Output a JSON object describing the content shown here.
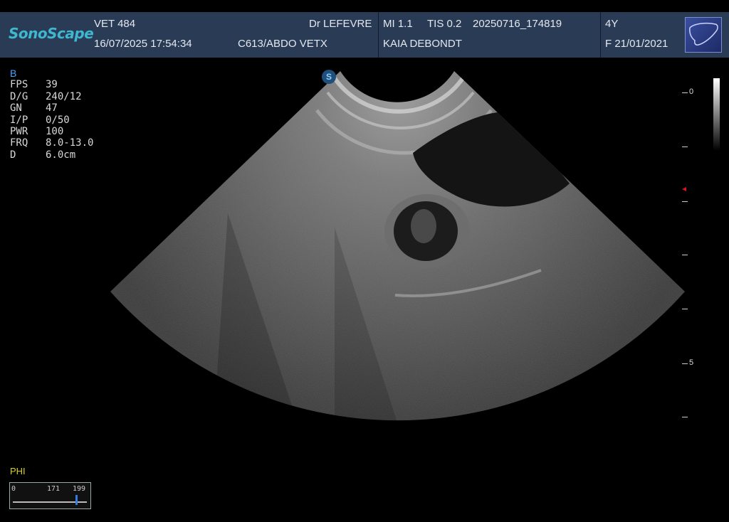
{
  "header": {
    "logo": "SonoScape",
    "institution": "VET 484",
    "datetime": "16/07/2025 17:54:34",
    "operator": "Dr LEFEVRE",
    "probe_preset": "C613/ABDO VETX",
    "mi": "MI  1.1",
    "tis": "TIS 0.2",
    "study_id": "20250716_174819",
    "patient_name": "KAIA DEBONDT",
    "age": "4Y",
    "sex_dob": "F  21/01/2021",
    "preset_icon": "liver-icon"
  },
  "params": {
    "mode": "B",
    "rows": [
      {
        "k": "FPS",
        "v": "39"
      },
      {
        "k": "D/G",
        "v": "240/12"
      },
      {
        "k": "GN",
        "v": "47"
      },
      {
        "k": "I/P",
        "v": "0/50"
      },
      {
        "k": "PWR",
        "v": "100"
      },
      {
        "k": "FRQ",
        "v": "8.0-13.0"
      },
      {
        "k": "D",
        "v": "6.0cm"
      }
    ]
  },
  "phi": {
    "label": "PHI",
    "scale_min": "0",
    "scale_mid": "171",
    "scale_max": "199"
  },
  "depth_scale": {
    "label_0": "0",
    "label_5": "5"
  },
  "probe_marker": "S",
  "colors": {
    "header_bg": "#2a3b55",
    "logo": "#3fb7d0",
    "mode": "#4aa3ff",
    "phi": "#d7d11a",
    "depth_marker": "#d12222"
  }
}
